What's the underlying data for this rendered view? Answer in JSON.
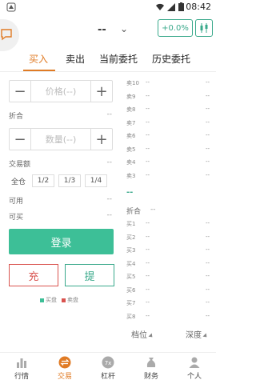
{
  "status_bar": {
    "time": "08:42"
  },
  "header": {
    "pair": "--",
    "change": "+0.0%"
  },
  "tabs": [
    {
      "label": "买入",
      "active": true
    },
    {
      "label": "卖出",
      "active": false
    },
    {
      "label": "当前委托",
      "active": false
    },
    {
      "label": "历史委托",
      "active": false
    }
  ],
  "form": {
    "price_placeholder": "价格(--)",
    "zhehe_label": "折合",
    "zhehe_value": "--",
    "qty_placeholder": "数量(--)",
    "amount_label": "交易额",
    "amount_value": "--",
    "percents": [
      "全仓",
      "1/2",
      "1/3",
      "1/4"
    ],
    "available_label": "可用",
    "available_value": "--",
    "buyable_label": "可买",
    "buyable_value": "--",
    "login_label": "登录",
    "deposit_label": "充",
    "withdraw_label": "提",
    "legend_buy": "买盘",
    "legend_sell": "卖盘"
  },
  "orderbook": {
    "asks": [
      {
        "label": "卖10",
        "price": "--",
        "qty": "--"
      },
      {
        "label": "卖9",
        "price": "--",
        "qty": "--"
      },
      {
        "label": "卖8",
        "price": "--",
        "qty": "--"
      },
      {
        "label": "卖7",
        "price": "--",
        "qty": "--"
      },
      {
        "label": "卖6",
        "price": "--",
        "qty": "--"
      },
      {
        "label": "卖5",
        "price": "--",
        "qty": "--"
      },
      {
        "label": "卖4",
        "price": "--",
        "qty": "--"
      },
      {
        "label": "卖3",
        "price": "--",
        "qty": "--"
      }
    ],
    "last_price": "--",
    "zhehe_label": "折合",
    "zhehe_value": "--",
    "bids": [
      {
        "label": "买1",
        "price": "--",
        "qty": "--"
      },
      {
        "label": "买2",
        "price": "--",
        "qty": "--"
      },
      {
        "label": "买3",
        "price": "--",
        "qty": "--"
      },
      {
        "label": "买4",
        "price": "--",
        "qty": "--"
      },
      {
        "label": "买5",
        "price": "--",
        "qty": "--"
      },
      {
        "label": "买6",
        "price": "--",
        "qty": "--"
      },
      {
        "label": "买7",
        "price": "--",
        "qty": "--"
      },
      {
        "label": "买8",
        "price": "--",
        "qty": "--"
      }
    ],
    "precision_label": "档位",
    "depth_label": "深度"
  },
  "bottom_nav": [
    {
      "label": "行情",
      "icon": "chart-bars-icon",
      "active": false
    },
    {
      "label": "交易",
      "icon": "exchange-icon",
      "active": true
    },
    {
      "label": "杠杆",
      "icon": "leverage-icon",
      "active": false
    },
    {
      "label": "财务",
      "icon": "finance-icon",
      "active": false
    },
    {
      "label": "个人",
      "icon": "person-icon",
      "active": false
    }
  ],
  "colors": {
    "accent": "#e07b25",
    "green": "#3dbf97",
    "red": "#d9534f"
  }
}
